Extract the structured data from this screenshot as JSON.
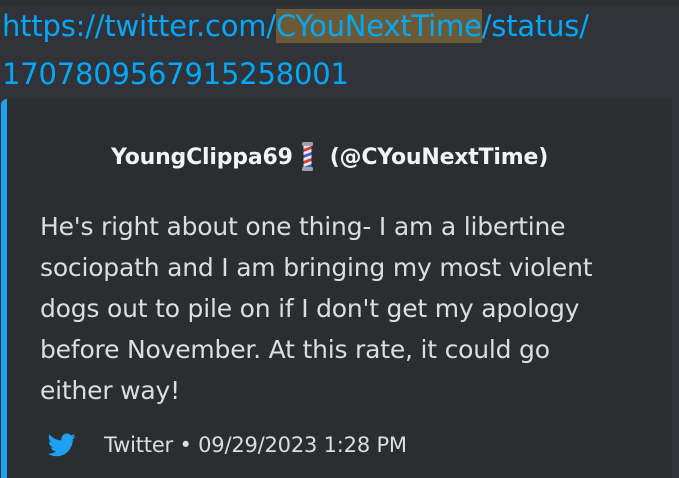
{
  "message": {
    "link_part1": "https://twitter.com/",
    "link_highlight": "CYouNextTime",
    "link_part2": "/status/",
    "link_line2": "1707809567915258001"
  },
  "embed": {
    "author_name": "YoungClippa69",
    "author_emoji": "barber-pole-icon",
    "author_handle": "(@CYouNextTime)",
    "text_lines": [
      "He's right about one thing- I am a libertine",
      "sociopath and I am bringing my most violent",
      "dogs out to pile on if I don't get my apology",
      "before November. At this rate, it could go",
      "either way!"
    ],
    "footer_icon": "twitter-bird-icon",
    "footer_text": "Twitter • 09/29/2023 1:28 PM",
    "accent_color": "#1da1f2"
  },
  "colors": {
    "background": "#313338",
    "embed_background": "#2b2d31",
    "link": "#00a8fc",
    "highlight": "#6b5a35"
  }
}
